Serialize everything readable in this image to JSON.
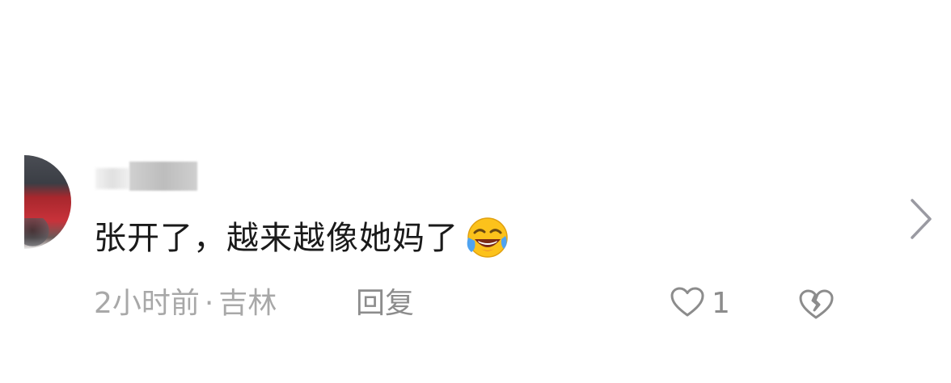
{
  "comment": {
    "text": "张开了，越来越像她妈了",
    "emoji": "crying-laughing-emoji",
    "time": "2小时前",
    "separator": "·",
    "location": "吉林",
    "reply_label": "回复",
    "like_count": "1",
    "icons": {
      "like": "heart-outline-icon",
      "dislike": "broken-heart-icon",
      "expand": "chevron-right-icon"
    }
  },
  "colors": {
    "text_primary": "#1a1a1a",
    "text_secondary": "#a8a8a8",
    "icon_gray": "#8c8c8c",
    "chevron_gray": "#9a9aa2"
  }
}
